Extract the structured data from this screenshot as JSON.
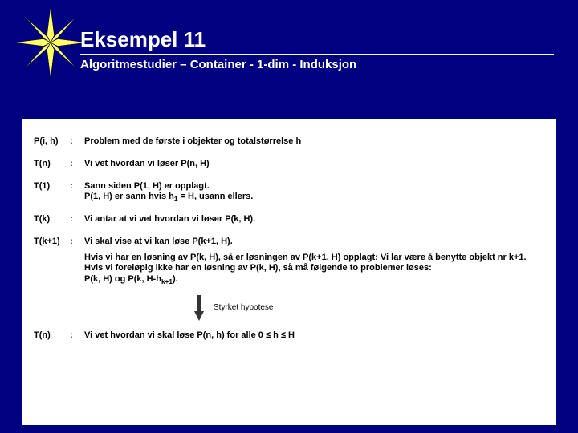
{
  "header": {
    "title": "Eksempel 11",
    "subtitle": "Algoritmestudier – Container   -   1-dim   -   Induksjon"
  },
  "rows": {
    "p_ih": {
      "label": "P(i, h)",
      "colon": ":",
      "text": "Problem med de første i objekter og totalstørrelse h"
    },
    "tn1": {
      "label": "T(n)",
      "colon": ":",
      "text": "Vi vet hvordan vi løser P(n, H)"
    },
    "t1": {
      "label": "T(1)",
      "colon": ":",
      "line1": "Sann siden P(1, H) er opplagt.",
      "line2a": "P(1, H) er sann hvis h",
      "line2_sub": "1",
      "line2b": " = H, usann ellers."
    },
    "tk": {
      "label": "T(k)",
      "colon": ":",
      "text": "Vi antar at vi vet hvordan vi løser P(k, H)."
    },
    "tk1": {
      "label": "T(k+1)",
      "colon": ":",
      "text": "Vi skal vise at vi kan løse P(k+1, H)."
    },
    "tn2": {
      "label": "T(n)",
      "colon": ":",
      "texta": "Vi vet hvordan vi skal løse P(n, h)  for alle 0 ",
      "leq1": "≤",
      "mid": " h ",
      "leq2": "≤",
      "textb": " H"
    }
  },
  "note": {
    "line1": "Hvis vi har en løsning av P(k, H), så er løsningen av P(k+1, H) opplagt: Vi lar være å benytte objekt nr k+1.",
    "line2": "Hvis vi foreløpig ikke har en løsning av P(k, H), så må følgende to problemer løses:",
    "line3a": "P(k, H) og P(k, H-h",
    "line3_sub": "k+1",
    "line3b": ")."
  },
  "hypothesis": "Styrket hypotese"
}
